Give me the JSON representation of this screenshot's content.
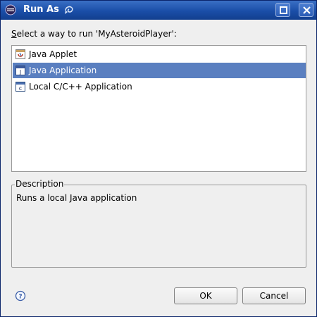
{
  "window": {
    "title": "Run As"
  },
  "prompt": {
    "prefix": "S",
    "rest": "elect a way to run 'MyAsteroidPlayer':"
  },
  "launch_options": [
    {
      "label": "Java Applet",
      "icon": "java-applet-icon"
    },
    {
      "label": "Java Application",
      "icon": "java-application-icon",
      "selected": true
    },
    {
      "label": "Local C/C++ Application",
      "icon": "c-application-icon"
    }
  ],
  "description": {
    "title": "Description",
    "text": "Runs a local Java application"
  },
  "buttons": {
    "ok": "OK",
    "cancel": "Cancel"
  },
  "colors": {
    "titlebar": "#1a4ea8",
    "selection": "#5a7fc0"
  }
}
